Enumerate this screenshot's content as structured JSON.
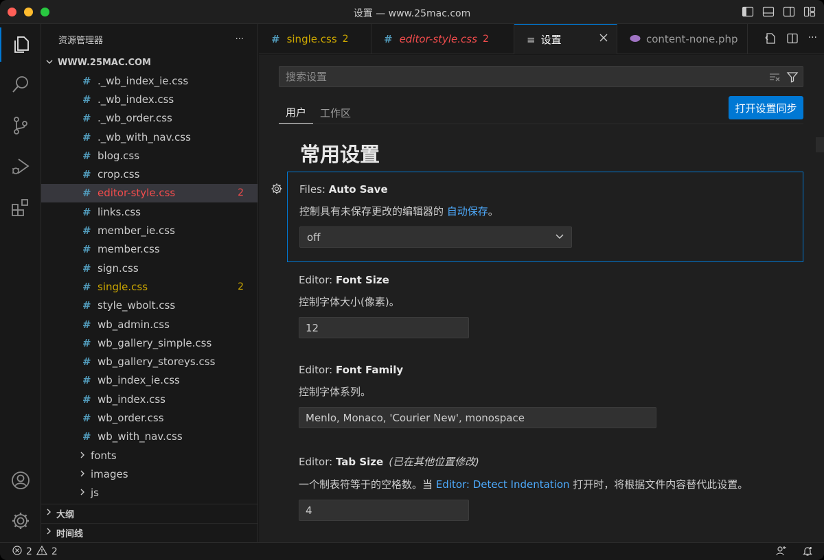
{
  "window": {
    "title": "设置 — www.25mac.com"
  },
  "sidebar": {
    "header": "资源管理器",
    "more": "···",
    "folder": "WWW.25MAC.COM",
    "files": [
      {
        "name": "._wb_index_ie.css",
        "badge": ""
      },
      {
        "name": "._wb_index.css",
        "badge": ""
      },
      {
        "name": "._wb_order.css",
        "badge": ""
      },
      {
        "name": "._wb_with_nav.css",
        "badge": ""
      },
      {
        "name": "blog.css",
        "badge": ""
      },
      {
        "name": "crop.css",
        "badge": ""
      },
      {
        "name": "editor-style.css",
        "badge": "2",
        "state": "error"
      },
      {
        "name": "links.css",
        "badge": ""
      },
      {
        "name": "member_ie.css",
        "badge": ""
      },
      {
        "name": "member.css",
        "badge": ""
      },
      {
        "name": "sign.css",
        "badge": ""
      },
      {
        "name": "single.css",
        "badge": "2",
        "state": "warning"
      },
      {
        "name": "style_wbolt.css",
        "badge": ""
      },
      {
        "name": "wb_admin.css",
        "badge": ""
      },
      {
        "name": "wb_gallery_simple.css",
        "badge": ""
      },
      {
        "name": "wb_gallery_storeys.css",
        "badge": ""
      },
      {
        "name": "wb_index_ie.css",
        "badge": ""
      },
      {
        "name": "wb_index.css",
        "badge": ""
      },
      {
        "name": "wb_order.css",
        "badge": ""
      },
      {
        "name": "wb_with_nav.css",
        "badge": ""
      }
    ],
    "folders": [
      "fonts",
      "images",
      "js"
    ],
    "outline": "大纲",
    "timeline": "时间线"
  },
  "tabs": [
    {
      "label": "single.css",
      "badge": "2",
      "icon": "#"
    },
    {
      "label": "editor-style.css",
      "badge": "2",
      "icon": "#"
    },
    {
      "label": "设置",
      "badge": "",
      "icon": "≡"
    },
    {
      "label": "content-none.php",
      "badge": "",
      "icon": "php-icon"
    }
  ],
  "settings": {
    "search_placeholder": "搜索设置",
    "scope_user": "用户",
    "scope_workspace": "工作区",
    "sync_button": "打开设置同步",
    "section_title": "常用设置",
    "items": [
      {
        "prefix": "Files: ",
        "name": "Auto Save",
        "desc": "控制具有未保存更改的编辑器的 ",
        "link": "自动保存",
        "desc_end": "。",
        "value": "off"
      },
      {
        "prefix": "Editor: ",
        "name": "Font Size",
        "desc": "控制字体大小(像素)。",
        "value": "12"
      },
      {
        "prefix": "Editor: ",
        "name": "Font Family",
        "desc": "控制字体系列。",
        "value": "Menlo, Monaco, 'Courier New', monospace"
      },
      {
        "prefix": "Editor: ",
        "name": "Tab Size",
        "modified": "(已在其他位置修改)",
        "desc": "一个制表符等于的空格数。当 ",
        "link": "Editor: Detect Indentation",
        "desc_end": " 打开时，将根据文件内容替代此设置。",
        "value": "4"
      }
    ]
  },
  "status": {
    "errors": "2",
    "warnings": "2"
  }
}
